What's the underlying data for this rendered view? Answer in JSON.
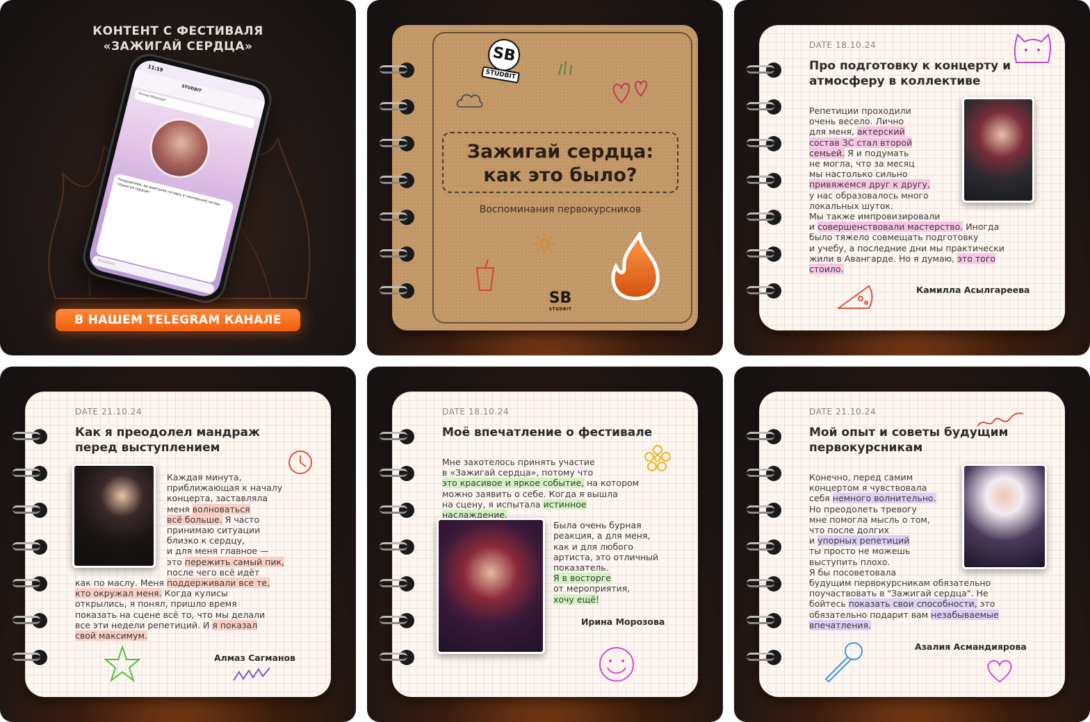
{
  "promo": {
    "heading_line1": "КОНТЕНТ С ФЕСТИВАЛЯ",
    "heading_line2": "«ЗАЖИГАЙ СЕРДЦА»",
    "button": "В НАШЕМ TELEGRAM КАНАЛЕ",
    "phone": {
      "time": "11:19",
      "channel": "STUDBIT",
      "pinned": "Pinned Message",
      "message": "Поздравляем, вы выиграли путевку в пионерский лагерь «Зажигай сердца»",
      "input": "Broadcast"
    }
  },
  "cover": {
    "logo_mark": "SB",
    "logo_word": "STUDBIT",
    "title_line1": "Зажигай сердца:",
    "title_line2": "как это было?",
    "subtitle": "Воспоминания первокурсников",
    "bottom_logo_mark": "SB",
    "bottom_logo_word": "STUDBIT"
  },
  "cards": [
    {
      "date": "DATE 18.10.24",
      "title": "Про подготовку к концерту и атмосферу в коллективе",
      "author": "Камилла Асылгареева",
      "lines": [
        [
          {
            "t": "Репетиции проходили"
          }
        ],
        [
          {
            "t": "очень весело. Лично"
          }
        ],
        [
          {
            "t": "для меня, "
          },
          {
            "t": "актерский",
            "hl": "pink"
          }
        ],
        [
          {
            "t": "состав ЗС стал второй",
            "hl": "pink"
          }
        ],
        [
          {
            "t": "семьей.",
            "hl": "pink"
          },
          {
            "t": " Я и подумать"
          }
        ],
        [
          {
            "t": "не могла, что за месяц"
          }
        ],
        [
          {
            "t": "мы настолько сильно"
          }
        ],
        [
          {
            "t": "привяжемся друг к другу,",
            "hl": "pink"
          }
        ],
        [
          {
            "t": "у нас образовалось много"
          }
        ],
        [
          {
            "t": "локальных шуток."
          }
        ],
        [
          {
            "t": "Мы также импровизировали"
          }
        ],
        [
          {
            "t": "и "
          },
          {
            "t": "совершенствовали мастерство.",
            "hl": "pink"
          },
          {
            "t": " Иногда"
          }
        ],
        [
          {
            "t": "было тяжело совмещать подготовку"
          }
        ],
        [
          {
            "t": "и учебу, а последние дни мы практически"
          }
        ],
        [
          {
            "t": "жили в Авангарде. Но я думаю, "
          },
          {
            "t": "это того",
            "hl": "pink"
          }
        ],
        [
          {
            "t": "стоило.",
            "hl": "pink"
          }
        ]
      ]
    },
    {
      "date": "DATE 21.10.24",
      "title": "Как я преодолел мандраж перед выступлением",
      "author": "Алмаз Сагманов",
      "lines": [
        [
          {
            "t": "Каждая минута,"
          }
        ],
        [
          {
            "t": "приближающая к началу"
          }
        ],
        [
          {
            "t": "концерта, заставляла"
          }
        ],
        [
          {
            "t": "меня "
          },
          {
            "t": "волноваться",
            "hl": "red"
          }
        ],
        [
          {
            "t": "всё больше.",
            "hl": "red"
          },
          {
            "t": " Я часто"
          }
        ],
        [
          {
            "t": "принимаю ситуации"
          }
        ],
        [
          {
            "t": "близко к сердцу,"
          }
        ],
        [
          {
            "t": "и для меня главное —"
          }
        ],
        [
          {
            "t": "это "
          },
          {
            "t": "пережить самый пик,",
            "hl": "red"
          }
        ],
        [
          {
            "t": "после чего всё идёт"
          }
        ],
        [
          {
            "t": "как по маслу. Меня "
          },
          {
            "t": "поддерживали все те,",
            "hl": "red"
          }
        ],
        [
          {
            "t": "кто окружал меня.",
            "hl": "red"
          },
          {
            "t": " Когда кулисы"
          }
        ],
        [
          {
            "t": "открылись, я понял, пришло время"
          }
        ],
        [
          {
            "t": "показать на сцене всё то, что мы делали"
          }
        ],
        [
          {
            "t": "все эти недели репетиций. И "
          },
          {
            "t": "я показал",
            "hl": "red"
          }
        ],
        [
          {
            "t": "свой максимум.",
            "hl": "red"
          }
        ]
      ]
    },
    {
      "date": "DATE 18.10.24",
      "title": "Моё впечатление о фестивале",
      "author": "Ирина Морозова",
      "lines": [
        [
          {
            "t": "Мне захотелось принять участие"
          }
        ],
        [
          {
            "t": "в «Зажигай сердца», потому что"
          }
        ],
        [
          {
            "t": "это красивое и яркое событие,",
            "hl": "green"
          },
          {
            "t": " на котором"
          }
        ],
        [
          {
            "t": "можно заявить о себе. Когда я вышла"
          }
        ],
        [
          {
            "t": "на сцену, я испытала "
          },
          {
            "t": "истинное",
            "hl": "green"
          }
        ],
        [
          {
            "t": "наслаждение.",
            "hl": "green"
          }
        ],
        [
          {
            "t": "Была очень бурная"
          }
        ],
        [
          {
            "t": "реакция, а для меня,"
          }
        ],
        [
          {
            "t": "как и для любого"
          }
        ],
        [
          {
            "t": "артиста, это отличный"
          }
        ],
        [
          {
            "t": "показатель."
          }
        ],
        [
          {
            "t": "Я в восторге",
            "hl": "green"
          }
        ],
        [
          {
            "t": "от мероприятия,"
          }
        ],
        [
          {
            "t": "хочу ещё!",
            "hl": "green"
          }
        ]
      ]
    },
    {
      "date": "DATE 21.10.24",
      "title": "Мой опыт и советы будущим первокурсникам",
      "author": "Азалия Асмандиярова",
      "lines": [
        [
          {
            "t": "Конечно, перед самим"
          }
        ],
        [
          {
            "t": "концертом я чувствовала"
          }
        ],
        [
          {
            "t": "себя "
          },
          {
            "t": "немного волнительно.",
            "hl": "purple"
          }
        ],
        [
          {
            "t": "Но преодолеть тревогу"
          }
        ],
        [
          {
            "t": "мне помогла мысль о том,"
          }
        ],
        [
          {
            "t": "что после долгих"
          }
        ],
        [
          {
            "t": "и "
          },
          {
            "t": "упорных репетиций",
            "hl": "purple"
          }
        ],
        [
          {
            "t": "ты просто не можешь"
          }
        ],
        [
          {
            "t": "выступить плохо."
          }
        ],
        [
          {
            "t": "Я бы посоветовала"
          }
        ],
        [
          {
            "t": "будущим первокурсникам обязательно"
          }
        ],
        [
          {
            "t": "поучаствовать в \"Зажигай сердца\". Не"
          }
        ],
        [
          {
            "t": "бойтесь "
          },
          {
            "t": "показать свои способности,",
            "hl": "purple"
          },
          {
            "t": " это"
          }
        ],
        [
          {
            "t": "обязательно подарит вам "
          },
          {
            "t": "незабываемые",
            "hl": "purple"
          }
        ],
        [
          {
            "t": "впечатления.",
            "hl": "purple"
          }
        ]
      ]
    }
  ],
  "icons": {
    "rings": "spiral-binding",
    "doodles": [
      "cat-icon",
      "pizza-icon",
      "clock-icon",
      "star-icon",
      "squiggle-icon",
      "flower-icon",
      "smiley-icon",
      "microphone-icon",
      "heart-icon",
      "cloud-icon",
      "sun-icon",
      "cup-icon",
      "flame-icon"
    ]
  },
  "colors": {
    "accent_orange": "#f05f10",
    "highlight_pink": "#f7c5e3",
    "highlight_red": "#f9cfc4",
    "highlight_green": "#d3f2c1",
    "highlight_purple": "#dcd0f5",
    "kraft": "#c49a6a"
  }
}
